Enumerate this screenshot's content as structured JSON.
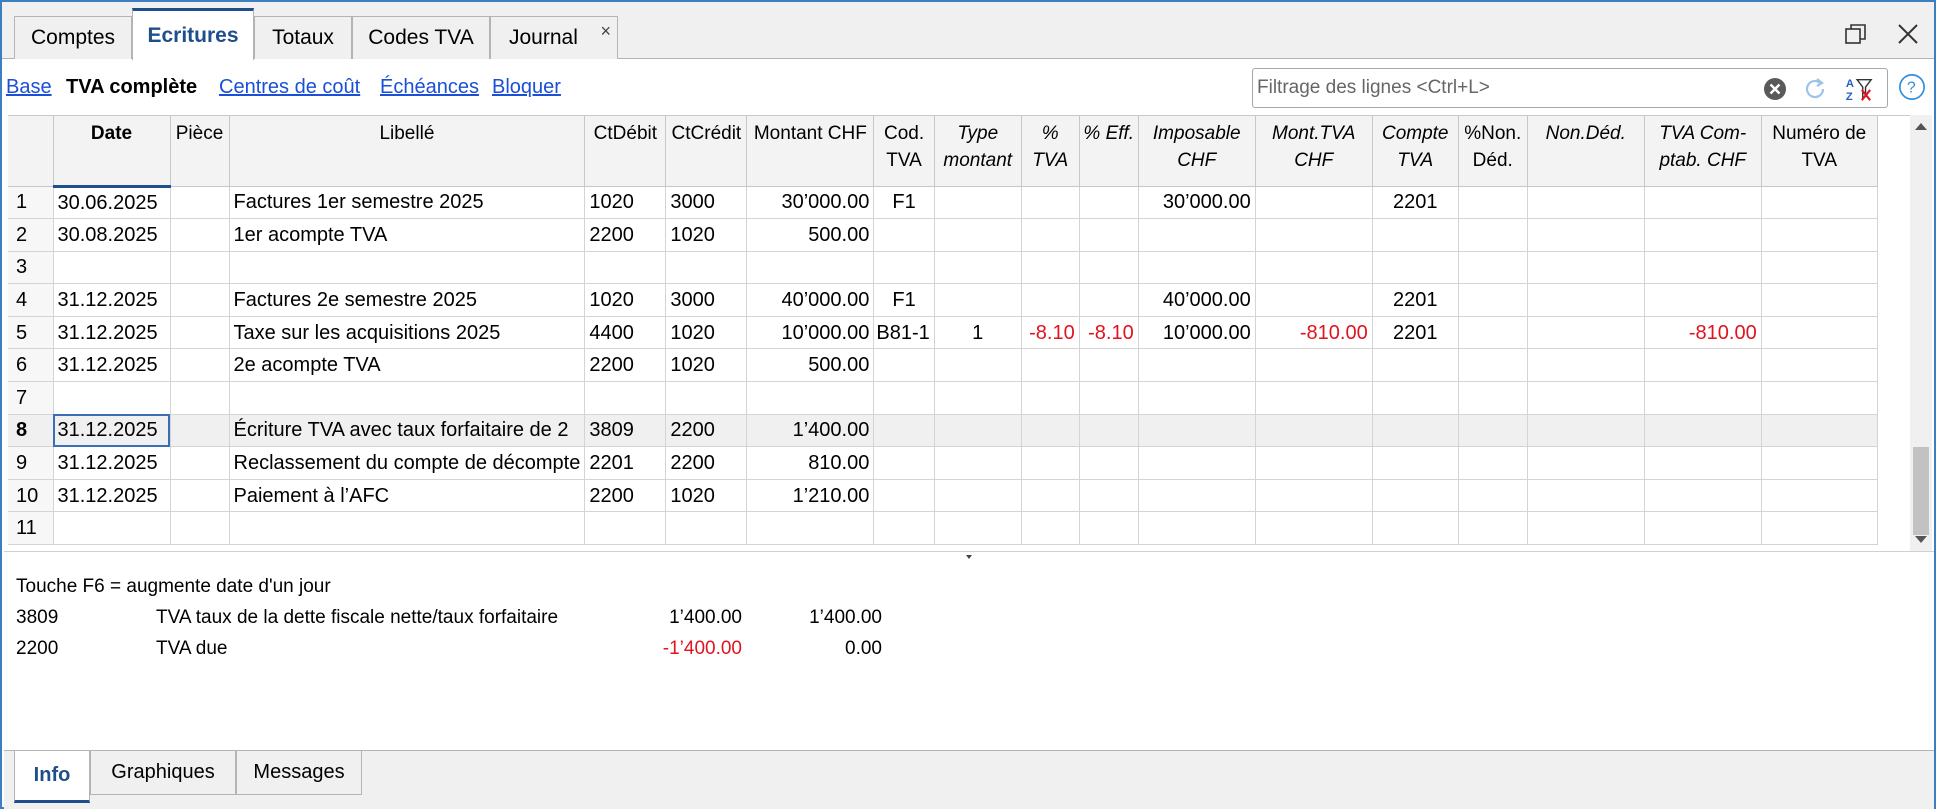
{
  "tabs": [
    {
      "label": "Comptes",
      "active": false
    },
    {
      "label": "Ecritures",
      "active": true
    },
    {
      "label": "Totaux",
      "active": false
    },
    {
      "label": "Codes TVA",
      "active": false
    },
    {
      "label": "Journal",
      "active": false
    }
  ],
  "tab_close_glyph": "×",
  "views": [
    {
      "label": "Base",
      "current": false
    },
    {
      "label": "TVA complète",
      "current": true
    },
    {
      "label": "Centres de coût",
      "current": false
    },
    {
      "label": "Échéances",
      "current": false
    },
    {
      "label": "Bloquer",
      "current": false
    }
  ],
  "filter": {
    "placeholder": "Filtrage des lignes <Ctrl+L>",
    "value": ""
  },
  "columns": [
    {
      "key": "rn",
      "label": "",
      "italic": false
    },
    {
      "key": "date",
      "label": "Date",
      "italic": false
    },
    {
      "key": "piece",
      "label": "Pièce",
      "italic": false
    },
    {
      "key": "libelle",
      "label": "Libellé",
      "italic": false
    },
    {
      "key": "ctdebit",
      "label": "CtDébit",
      "italic": false
    },
    {
      "key": "ctcredit",
      "label": "CtCrédit",
      "italic": false
    },
    {
      "key": "montant",
      "label": "Montant CHF",
      "italic": false
    },
    {
      "key": "codtva",
      "label": "Cod. TVA",
      "italic": false
    },
    {
      "key": "typemontant",
      "label": "Type montant",
      "italic": true
    },
    {
      "key": "pcttva",
      "label": "% TVA",
      "italic": true
    },
    {
      "key": "pcteff",
      "label": "% Eff.",
      "italic": true
    },
    {
      "key": "imposable",
      "label": "Imposable CHF",
      "italic": true
    },
    {
      "key": "monttva",
      "label": "Mont.TVA CHF",
      "italic": true
    },
    {
      "key": "comptetva",
      "label": "Compte TVA",
      "italic": true
    },
    {
      "key": "pctnonded",
      "label": "%Non. Déd.",
      "italic": false
    },
    {
      "key": "nonded",
      "label": "Non.Déd.",
      "italic": true
    },
    {
      "key": "tvacomptab",
      "label": "TVA Com- ptab. CHF",
      "italic": true
    },
    {
      "key": "numtva",
      "label": "Numéro de TVA",
      "italic": false
    }
  ],
  "rows": [
    {
      "rn": "1",
      "date": "30.06.2025",
      "piece": "",
      "libelle": "Factures 1er semestre 2025",
      "ctdebit": "1020",
      "ctcredit": "3000",
      "montant": "30’000.00",
      "codtva": "F1",
      "typemontant": "",
      "pcttva": "",
      "pcteff": "",
      "imposable": "30’000.00",
      "monttva": "",
      "comptetva": "2201",
      "pctnonded": "",
      "nonded": "",
      "tvacomptab": "",
      "numtva": ""
    },
    {
      "rn": "2",
      "date": "30.08.2025",
      "piece": "",
      "libelle": "1er acompte TVA",
      "ctdebit": "2200",
      "ctcredit": "1020",
      "montant": "500.00",
      "codtva": "",
      "typemontant": "",
      "pcttva": "",
      "pcteff": "",
      "imposable": "",
      "monttva": "",
      "comptetva": "",
      "pctnonded": "",
      "nonded": "",
      "tvacomptab": "",
      "numtva": ""
    },
    {
      "rn": "3",
      "date": "",
      "piece": "",
      "libelle": "",
      "ctdebit": "",
      "ctcredit": "",
      "montant": "",
      "codtva": "",
      "typemontant": "",
      "pcttva": "",
      "pcteff": "",
      "imposable": "",
      "monttva": "",
      "comptetva": "",
      "pctnonded": "",
      "nonded": "",
      "tvacomptab": "",
      "numtva": ""
    },
    {
      "rn": "4",
      "date": "31.12.2025",
      "piece": "",
      "libelle": "Factures 2e semestre 2025",
      "ctdebit": "1020",
      "ctcredit": "3000",
      "montant": "40’000.00",
      "codtva": "F1",
      "typemontant": "",
      "pcttva": "",
      "pcteff": "",
      "imposable": "40’000.00",
      "monttva": "",
      "comptetva": "2201",
      "pctnonded": "",
      "nonded": "",
      "tvacomptab": "",
      "numtva": ""
    },
    {
      "rn": "5",
      "date": "31.12.2025",
      "piece": "",
      "libelle": "Taxe sur les acquisitions 2025",
      "ctdebit": "4400",
      "ctcredit": "1020",
      "montant": "10’000.00",
      "codtva": "B81-1",
      "typemontant": "1",
      "pcttva": "-8.10",
      "pcteff": "-8.10",
      "imposable": "10’000.00",
      "monttva": "-810.00",
      "comptetva": "2201",
      "pctnonded": "",
      "nonded": "",
      "tvacomptab": "-810.00",
      "numtva": ""
    },
    {
      "rn": "6",
      "date": "31.12.2025",
      "piece": "",
      "libelle": "2e acompte TVA",
      "ctdebit": "2200",
      "ctcredit": "1020",
      "montant": "500.00",
      "codtva": "",
      "typemontant": "",
      "pcttva": "",
      "pcteff": "",
      "imposable": "",
      "monttva": "",
      "comptetva": "",
      "pctnonded": "",
      "nonded": "",
      "tvacomptab": "",
      "numtva": ""
    },
    {
      "rn": "7",
      "date": "",
      "piece": "",
      "libelle": "",
      "ctdebit": "",
      "ctcredit": "",
      "montant": "",
      "codtva": "",
      "typemontant": "",
      "pcttva": "",
      "pcteff": "",
      "imposable": "",
      "monttva": "",
      "comptetva": "",
      "pctnonded": "",
      "nonded": "",
      "tvacomptab": "",
      "numtva": ""
    },
    {
      "rn": "8",
      "date": "31.12.2025",
      "piece": "",
      "libelle": "Écriture TVA avec taux forfaitaire de 2",
      "ctdebit": "3809",
      "ctcredit": "2200",
      "montant": "1’400.00",
      "codtva": "",
      "typemontant": "",
      "pcttva": "",
      "pcteff": "",
      "imposable": "",
      "monttva": "",
      "comptetva": "",
      "pctnonded": "",
      "nonded": "",
      "tvacomptab": "",
      "numtva": ""
    },
    {
      "rn": "9",
      "date": "31.12.2025",
      "piece": "",
      "libelle": "Reclassement du compte de décompte",
      "ctdebit": "2201",
      "ctcredit": "2200",
      "montant": "810.00",
      "codtva": "",
      "typemontant": "",
      "pcttva": "",
      "pcteff": "",
      "imposable": "",
      "monttva": "",
      "comptetva": "",
      "pctnonded": "",
      "nonded": "",
      "tvacomptab": "",
      "numtva": ""
    },
    {
      "rn": "10",
      "date": "31.12.2025",
      "piece": "",
      "libelle": "Paiement à l’AFC",
      "ctdebit": "2200",
      "ctcredit": "1020",
      "montant": "1’210.00",
      "codtva": "",
      "typemontant": "",
      "pcttva": "",
      "pcteff": "",
      "imposable": "",
      "monttva": "",
      "comptetva": "",
      "pctnonded": "",
      "nonded": "",
      "tvacomptab": "",
      "numtva": ""
    },
    {
      "rn": "11",
      "date": "",
      "piece": "",
      "libelle": "",
      "ctdebit": "",
      "ctcredit": "",
      "montant": "",
      "codtva": "",
      "typemontant": "",
      "pcttva": "",
      "pcteff": "",
      "imposable": "",
      "monttva": "",
      "comptetva": "",
      "pctnonded": "",
      "nonded": "",
      "tvacomptab": "",
      "numtva": ""
    }
  ],
  "selected_row": "8",
  "negative_color": "#e0131f",
  "info": {
    "hint": "Touche F6 = augmente date d'un jour",
    "lines": [
      {
        "account": "3809",
        "description": "TVA taux de la dette fiscale nette/taux forfaitaire",
        "amount": "1’400.00",
        "balance": "1’400.00",
        "negative": false
      },
      {
        "account": "2200",
        "description": "TVA due",
        "amount": "-1’400.00",
        "balance": "0.00",
        "negative": true
      }
    ]
  },
  "bottom_tabs": [
    {
      "label": "Info",
      "active": true
    },
    {
      "label": "Graphiques",
      "active": false
    },
    {
      "label": "Messages",
      "active": false
    }
  ],
  "accent_color": "#1f4e8c",
  "link_color": "#1a4fd6"
}
